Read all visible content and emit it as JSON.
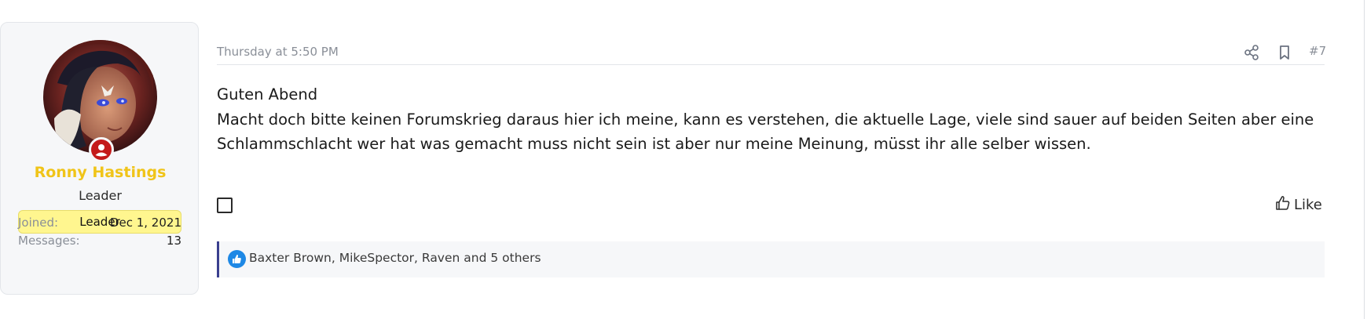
{
  "user": {
    "name": "Ronny Hastings",
    "title": "Leader",
    "banner": "Leader",
    "stats": [
      {
        "label": "Joined:",
        "value": "Dec 1, 2021"
      },
      {
        "label": "Messages:",
        "value": "13"
      }
    ]
  },
  "post": {
    "date": "Thursday at 5:50 PM",
    "number": "#7",
    "lines": [
      "Guten Abend",
      "Macht doch bitte keinen Forumskrieg daraus hier ich meine, kann es verstehen, die aktuelle Lage, viele sind sauer auf beiden Seiten aber eine",
      "Schlammschlacht wer hat was gemacht muss nicht sein ist aber nur meine Meinung, müsst ihr alle selber wissen."
    ],
    "like_label": "Like",
    "reactions_text": "Baxter Brown, MikeSpector, Raven and 5 others"
  },
  "colors": {
    "username": "#f0c419",
    "banner_bg": "#fff68f",
    "reaction_bar_accent": "#3a3f8f",
    "like_icon": "#1e88e5",
    "online_badge": "#c41a1a"
  },
  "icons": {
    "share": "share-icon",
    "bookmark": "bookmark-icon",
    "like": "thumbs-up-icon",
    "reaction": "like-reaction-icon",
    "online": "online-status-icon"
  }
}
